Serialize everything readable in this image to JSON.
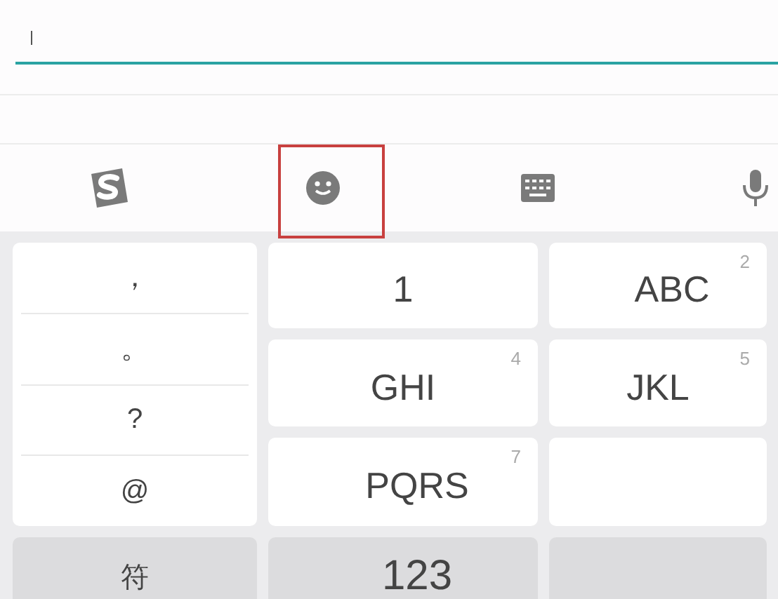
{
  "toolbar": [
    {
      "kind": "logo",
      "highlighted": false
    },
    {
      "kind": "emoji",
      "highlighted": true
    },
    {
      "kind": "keyboard",
      "highlighted": false
    },
    {
      "kind": "mic",
      "highlighted": false
    }
  ],
  "symbols": [
    "，",
    "。",
    "?",
    "@"
  ],
  "keys": [
    {
      "kind": "key",
      "label": "1"
    },
    {
      "kind": "key",
      "label": "ABC",
      "digit": "2"
    },
    {
      "kind": "key",
      "label": "GHI",
      "digit": "4"
    },
    {
      "kind": "key",
      "label": "JKL",
      "digit": "5"
    },
    {
      "kind": "key",
      "label": "PQRS",
      "digit": "7"
    },
    {
      "kind": "blank"
    }
  ],
  "bottom_keys": [
    {
      "kind": "key",
      "label": "符"
    },
    {
      "kind": "key",
      "label": "123"
    },
    {
      "kind": "blank"
    }
  ]
}
